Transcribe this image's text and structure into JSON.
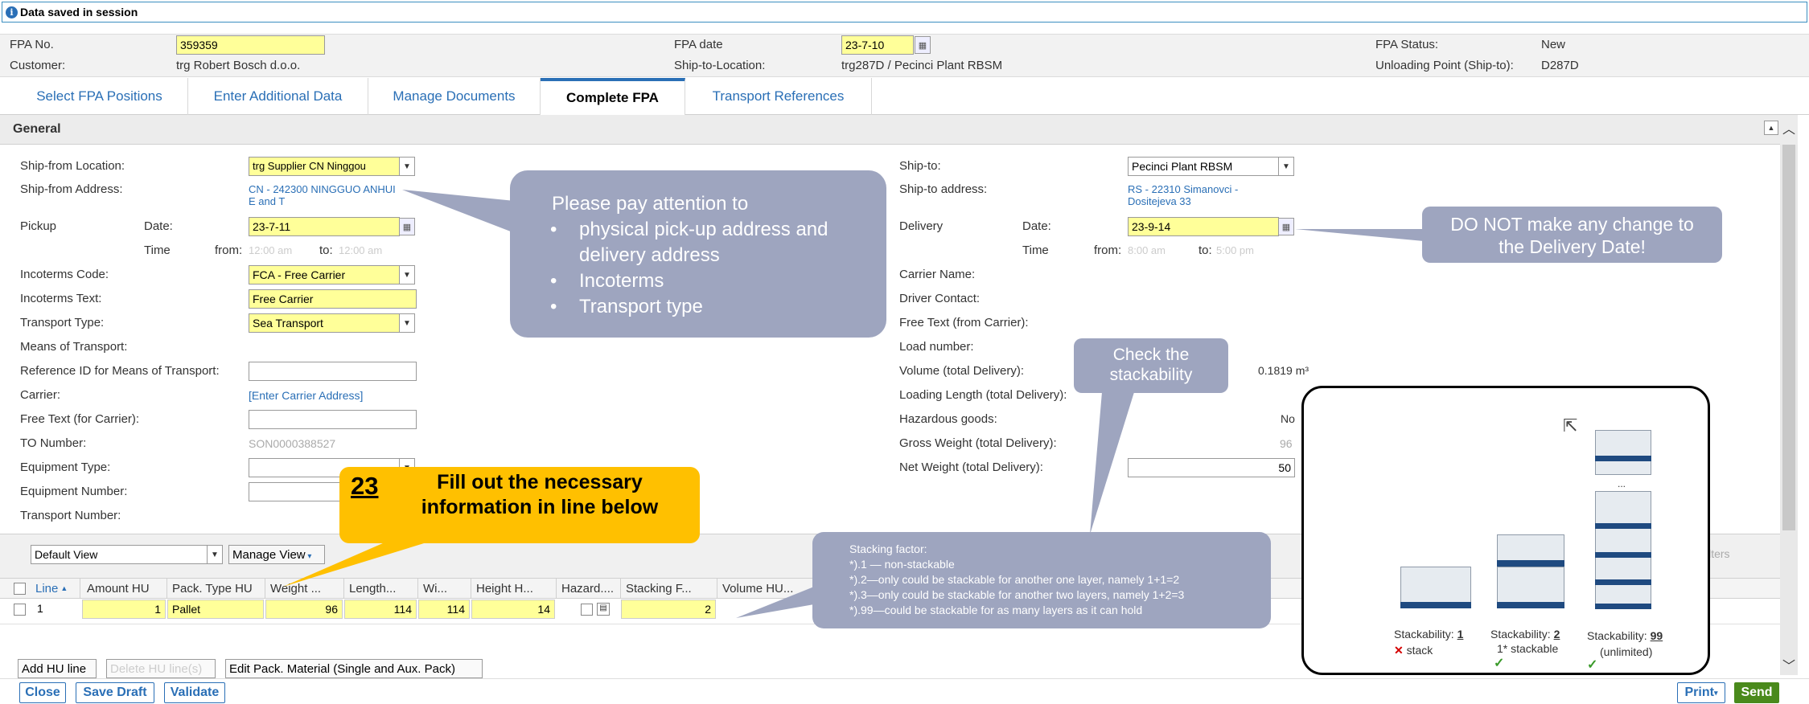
{
  "message": "Data saved in session",
  "header": {
    "fpa_no_label": "FPA No.",
    "fpa_no_value": "359359",
    "fpa_date_label": "FPA date",
    "fpa_date_value": "23-7-10",
    "fpa_status_label": "FPA Status:",
    "fpa_status_value": "New",
    "customer_label": "Customer:",
    "customer_value": "trg Robert Bosch d.o.o.",
    "ship_to_location_label": "Ship-to-Location:",
    "ship_to_location_value": "trg287D / Pecinci Plant RBSM",
    "unloading_point_label": "Unloading Point (Ship-to):",
    "unloading_point_value": "D287D"
  },
  "tabs": [
    {
      "label": "Select FPA Positions"
    },
    {
      "label": "Enter Additional Data"
    },
    {
      "label": "Manage Documents"
    },
    {
      "label": "Complete FPA"
    },
    {
      "label": "Transport References"
    }
  ],
  "panel_title": "General",
  "left_form": {
    "ship_from_location_label": "Ship-from Location:",
    "ship_from_location_value": "trg Supplier CN Ninggou",
    "ship_from_address_label": "Ship-from Address:",
    "ship_from_address_line1": "CN - 242300 NINGGUO ANHUI",
    "ship_from_address_line2": "E and T",
    "pickup_label": "Pickup",
    "date_label": "Date:",
    "pickup_date": "23-7-11",
    "time_label": "Time",
    "from_label": "from:",
    "from_placeholder": "12:00 am",
    "to_label": "to:",
    "to_placeholder": "12:00 am",
    "incoterms_code_label": "Incoterms Code:",
    "incoterms_code_value": "FCA - Free Carrier",
    "incoterms_text_label": "Incoterms Text:",
    "incoterms_text_value": "Free Carrier",
    "transport_type_label": "Transport Type:",
    "transport_type_value": "Sea Transport",
    "means_label": "Means of Transport:",
    "ref_id_label": "Reference ID for Means of Transport:",
    "carrier_label": "Carrier:",
    "carrier_link": "[Enter Carrier Address]",
    "free_text_label": "Free Text (for Carrier):",
    "to_number_label": "TO Number:",
    "to_number_value": "SON0000388527",
    "equipment_type_label": "Equipment Type:",
    "equipment_number_label": "Equipment Number:",
    "transport_number_label": "Transport Number:"
  },
  "right_form": {
    "ship_to_label": "Ship-to:",
    "ship_to_value": "Pecinci Plant RBSM",
    "ship_to_address_label": "Ship-to address:",
    "ship_to_address_line1": "RS - 22310 Simanovci -",
    "ship_to_address_line2": "Dositejeva 33",
    "delivery_label": "Delivery",
    "date_label": "Date:",
    "delivery_date": "23-9-14",
    "time_label": "Time",
    "from_label": "from:",
    "from_placeholder": "8:00 am",
    "to_label": "to:",
    "to_placeholder": "5:00 pm",
    "carrier_name_label": "Carrier Name:",
    "driver_contact_label": "Driver Contact:",
    "free_text_label": "Free Text (from Carrier):",
    "load_number_label": "Load number:",
    "volume_label": "Volume (total Delivery):",
    "volume_value": "0.1819 m³",
    "loading_length_label": "Loading Length (total Delivery):",
    "hazardous_label": "Hazardous goods:",
    "hazardous_value": "No",
    "gross_weight_label": "Gross Weight (total Delivery):",
    "gross_weight_value": "96",
    "net_weight_label": "Net Weight (total Delivery):",
    "net_weight_value": "50"
  },
  "callouts": {
    "attention_title": "Please pay attention to",
    "attention_items": [
      "physical pick-up address and delivery address",
      "Incoterms",
      "Transport type"
    ],
    "delivery_date": "DO NOT make any change to the Delivery Date!",
    "stackability": "Check the stackability",
    "step_number": "23",
    "step_text": "Fill out the necessary information in line below",
    "stacking_title": "Stacking factor:",
    "stacking_lines": [
      "*).1 — non-stackable",
      "*).2—only could be stackable for another one layer, namely 1+1=2",
      "*).3—only could be stackable for another two layers, namely 1+2=3",
      "*).99—could be stackable for as many layers as it can hold"
    ]
  },
  "stack_image": {
    "s1_label": "Stackability:",
    "s1_value": "1",
    "s1_sub": "stack",
    "s2_label": "Stackability:",
    "s2_value": "2",
    "s2_sub": "1* stackable",
    "s3_label": "Stackability:",
    "s3_value": "99",
    "s3_sub": "(unlimited)",
    "ellipsis": "..."
  },
  "grid": {
    "view_value": "Default View",
    "manage_view": "Manage View",
    "filters_label": "ilters",
    "columns": [
      "Line",
      "Amount HU",
      "Pack. Type HU",
      "Weight ...",
      "Length...",
      "Wi...",
      "Height H...",
      "Hazard....",
      "Stacking F...",
      "Volume HU..."
    ],
    "row": {
      "line": "1",
      "amount": "1",
      "pack_type": "Pallet",
      "weight": "96",
      "length": "114",
      "width": "114",
      "height": "14",
      "stacking": "2"
    },
    "add_hu_line": "Add HU line",
    "delete_hu_line": "Delete HU line(s)",
    "edit_pack": "Edit Pack. Material (Single and Aux. Pack)"
  },
  "bottom": {
    "close": "Close",
    "save_draft": "Save Draft",
    "validate": "Validate",
    "print": "Print",
    "send": "Send"
  },
  "colors": {
    "accent": "#2a6fb6",
    "required": "#ffff99",
    "callout": "#9ea5bf",
    "step_callout": "#ffc000",
    "send": "#4a8a1c"
  }
}
